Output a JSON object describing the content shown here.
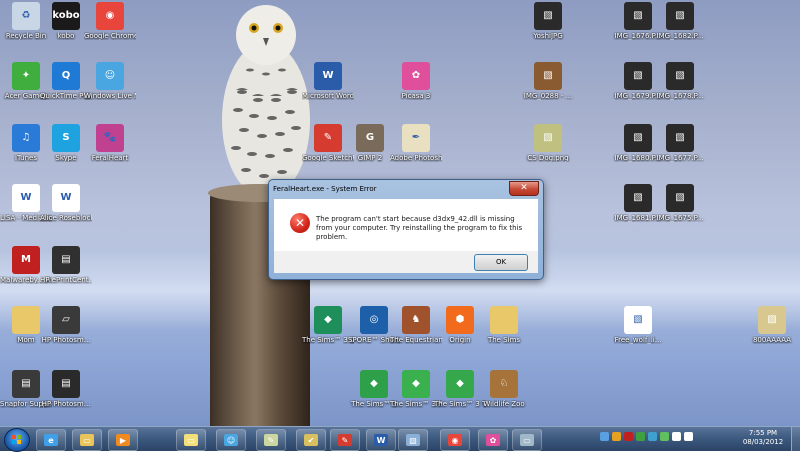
{
  "desktop": {
    "icons": [
      {
        "label": "Recycle Bin",
        "icon": "recycle-bin-icon",
        "color": "#c8d6e6",
        "glyph": "♻"
      },
      {
        "label": "kobo",
        "icon": "kobo-icon",
        "color": "#1a1a1a",
        "glyph": "kobo"
      },
      {
        "label": "Google Chrome",
        "icon": "chrome-icon",
        "color": "#e8453c",
        "glyph": "◉"
      },
      {
        "label": "Acer Games",
        "icon": "acer-games-icon",
        "color": "#3fae3f",
        "glyph": "✦"
      },
      {
        "label": "QuickTime Player",
        "icon": "quicktime-icon",
        "color": "#1f7ad6",
        "glyph": "Q"
      },
      {
        "label": "Windows Live Mes...",
        "icon": "messenger-icon",
        "color": "#4aa6e0",
        "glyph": "☺"
      },
      {
        "label": "iTunes",
        "icon": "itunes-icon",
        "color": "#2a7ad8",
        "glyph": "♫"
      },
      {
        "label": "Skype",
        "icon": "skype-icon",
        "color": "#1fa2e0",
        "glyph": "S"
      },
      {
        "label": "FeralHeart",
        "icon": "paw-icon",
        "color": "#c0418f",
        "glyph": "🐾"
      },
      {
        "label": "LISA - Mediation...",
        "icon": "word-document-icon",
        "color": "#ffffff",
        "glyph": "W"
      },
      {
        "label": "Alice Roseblock",
        "icon": "word-document-icon",
        "color": "#ffffff",
        "glyph": "W"
      },
      {
        "label": "Malwareby... Anti-Malw...",
        "icon": "malwarebytes-icon",
        "color": "#c02020",
        "glyph": "M"
      },
      {
        "label": "HP ePrintCent...",
        "icon": "printer-icon",
        "color": "#303030",
        "glyph": "▤"
      },
      {
        "label": "Mom",
        "icon": "folder-icon",
        "color": "#e9c86a",
        "glyph": ""
      },
      {
        "label": "HP Photosm...",
        "icon": "hp-photosmart-icon",
        "color": "#3a3a3a",
        "glyph": "▱"
      },
      {
        "label": "Snapfor Supplies - ...",
        "icon": "printer-icon",
        "color": "#3a3a3a",
        "glyph": "▤"
      },
      {
        "label": "HP Photosm...",
        "icon": "printer-icon",
        "color": "#2a2a2a",
        "glyph": "▤"
      },
      {
        "label": "Microsoft Word Starter...",
        "icon": "word-starter-icon",
        "color": "#2b5caa",
        "glyph": "W"
      },
      {
        "label": "Picasa 3",
        "icon": "picasa-icon",
        "color": "#e04f9c",
        "glyph": "✿"
      },
      {
        "label": "Google SketchUp 8",
        "icon": "sketchup-icon",
        "color": "#d53b2e",
        "glyph": "✎"
      },
      {
        "label": "GIMP 2",
        "icon": "gimp-icon",
        "color": "#7a6a5a",
        "glyph": "G"
      },
      {
        "label": "Adobe Photosh...",
        "icon": "photoshop-elements-icon",
        "color": "#e8e0c0",
        "glyph": "✒"
      },
      {
        "label": "The Sims™ 3 Create a W...",
        "icon": "sims-create-icon",
        "color": "#1e8f5a",
        "glyph": "◆"
      },
      {
        "label": "SPORE™ Shortcut",
        "icon": "spore-icon",
        "color": "#1d5fa8",
        "glyph": "◎"
      },
      {
        "label": "The Equestrian",
        "icon": "horse-icon",
        "color": "#a0522d",
        "glyph": "♞"
      },
      {
        "label": "Origin",
        "icon": "origin-icon",
        "color": "#f26a1b",
        "glyph": "⬢"
      },
      {
        "label": "The Sims",
        "icon": "folder-icon",
        "color": "#e9c86a",
        "glyph": ""
      },
      {
        "label": "The Sims™ 3",
        "icon": "sims3-icon",
        "color": "#2ea04a",
        "glyph": "◆"
      },
      {
        "label": "The Sims™ 3 Pets",
        "icon": "sims3-pets-icon",
        "color": "#3ab04f",
        "glyph": "◆"
      },
      {
        "label": "The Sims™ 3 Town Life...",
        "icon": "sims3-townlife-icon",
        "color": "#35a84c",
        "glyph": "◆"
      },
      {
        "label": "Wildlife Zoo",
        "icon": "zoo-icon",
        "color": "#a6743a",
        "glyph": "♘"
      },
      {
        "label": "YoshiJPG",
        "icon": "image-file-icon",
        "color": "#2a2a2a",
        "glyph": "▧"
      },
      {
        "label": "IMG_0288 - ...",
        "icon": "image-file-icon",
        "color": "#8a5a30",
        "glyph": "▧"
      },
      {
        "label": "CS Dog.png",
        "icon": "image-file-icon",
        "color": "#c0c080",
        "glyph": "▧"
      },
      {
        "label": "IMG_1676.P...",
        "icon": "image-file-icon",
        "color": "#2a2a2a",
        "glyph": "▧"
      },
      {
        "label": "IMG_1682.P...",
        "icon": "image-file-icon",
        "color": "#2a2a2a",
        "glyph": "▧"
      },
      {
        "label": "IMG_1679.P...",
        "icon": "image-file-icon",
        "color": "#2a2a2a",
        "glyph": "▧"
      },
      {
        "label": "IMG_1678.P...",
        "icon": "image-file-icon",
        "color": "#2a2a2a",
        "glyph": "▧"
      },
      {
        "label": "IMG_1680.P...",
        "icon": "image-file-icon",
        "color": "#2a2a2a",
        "glyph": "▧"
      },
      {
        "label": "IMG_1677.P...",
        "icon": "image-file-icon",
        "color": "#2a2a2a",
        "glyph": "▧"
      },
      {
        "label": "IMG_1681.P...",
        "icon": "image-file-icon",
        "color": "#2a2a2a",
        "glyph": "▧"
      },
      {
        "label": "IMG_1675.P...",
        "icon": "image-file-icon",
        "color": "#2a2a2a",
        "glyph": "▧"
      },
      {
        "label": "Free_wolf_li...",
        "icon": "image-file-icon",
        "color": "#ffffff",
        "glyph": "▧"
      },
      {
        "label": "800AAAAA",
        "icon": "image-file-icon",
        "color": "#d8c890",
        "glyph": "▧"
      }
    ]
  },
  "dialog": {
    "title": "FeralHeart.exe - System Error",
    "close_glyph": "✕",
    "error_glyph": "✕",
    "message": "The program can't start because d3dx9_42.dll is missing from your computer. Try reinstalling the program to fix this problem.",
    "ok_label": "OK"
  },
  "taskbar": {
    "items": [
      {
        "icon": "internet-explorer-icon",
        "glyph": "e",
        "color": "#3fa0e8"
      },
      {
        "icon": "file-explorer-icon",
        "glyph": "▭",
        "color": "#e8c45a"
      },
      {
        "icon": "media-player-icon",
        "glyph": "▶",
        "color": "#f08a1e"
      },
      {
        "icon": "sticky-notes-icon",
        "glyph": "▭",
        "color": "#f4e07a"
      },
      {
        "icon": "messenger-icon",
        "glyph": "☺",
        "color": "#4aa6e0"
      },
      {
        "icon": "notepad-icon",
        "glyph": "✎",
        "color": "#ccd6a0"
      },
      {
        "icon": "checklist-icon",
        "glyph": "✔",
        "color": "#d8c060"
      },
      {
        "icon": "sketch-icon",
        "glyph": "✎",
        "color": "#d53b2e"
      },
      {
        "icon": "word-icon",
        "glyph": "W",
        "color": "#2b5caa"
      },
      {
        "icon": "pictures-icon",
        "glyph": "▧",
        "color": "#8ab0d8"
      },
      {
        "icon": "chrome-icon",
        "glyph": "◉",
        "color": "#e8453c"
      },
      {
        "icon": "picasa-icon",
        "glyph": "✿",
        "color": "#e04f9c"
      },
      {
        "icon": "display-icon",
        "glyph": "▭",
        "color": "#a0b8c8"
      }
    ],
    "tray": [
      {
        "icon": "network-icon",
        "color": "#5aa0e0"
      },
      {
        "icon": "shield-icon",
        "color": "#e8a020"
      },
      {
        "icon": "security-icon",
        "color": "#c02020"
      },
      {
        "icon": "update-icon",
        "color": "#40a040"
      },
      {
        "icon": "sync-icon",
        "color": "#40a0d0"
      },
      {
        "icon": "battery-icon",
        "color": "#60c060"
      },
      {
        "icon": "signal-icon",
        "color": "#ffffff"
      },
      {
        "icon": "volume-icon",
        "color": "#ffffff"
      }
    ],
    "time": "7:55 PM",
    "date": "08/03/2012"
  }
}
